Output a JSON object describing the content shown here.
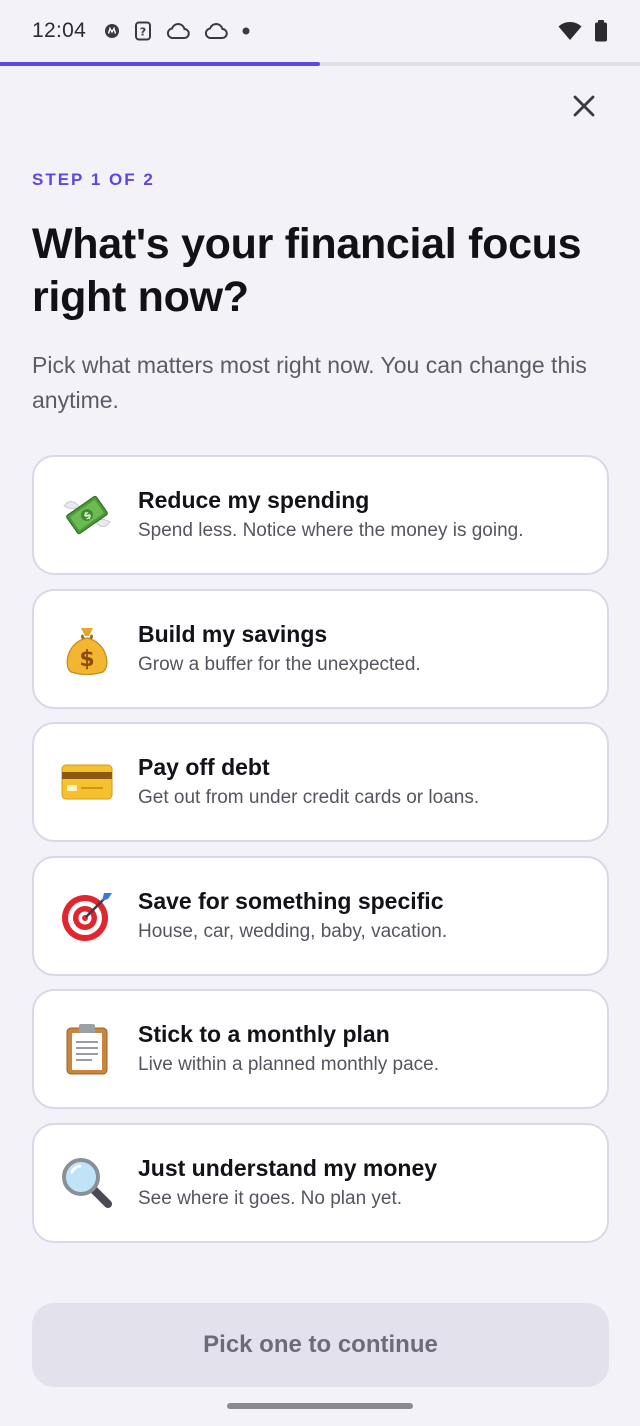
{
  "status_bar": {
    "time": "12:04",
    "icons_left": [
      "circle-badge-icon",
      "sim-question-icon",
      "cloud-icon",
      "cloud-icon",
      "dot-icon"
    ],
    "icons_right": [
      "wifi-icon",
      "battery-icon"
    ]
  },
  "progress": {
    "fraction": 0.5,
    "color": "#5b48e0"
  },
  "header": {
    "step": "STEP 1 OF 2",
    "title": "What's your financial focus right now?",
    "subtitle": "Pick what matters most right now. You can change this anytime."
  },
  "options": [
    {
      "icon": "money-with-wings-icon",
      "title": "Reduce my spending",
      "description": "Spend less. Notice where the money is going."
    },
    {
      "icon": "money-bag-icon",
      "title": "Build my savings",
      "description": "Grow a buffer for the unexpected."
    },
    {
      "icon": "credit-card-icon",
      "title": "Pay off debt",
      "description": "Get out from under credit cards or loans."
    },
    {
      "icon": "target-icon",
      "title": "Save for something specific",
      "description": "House, car, wedding, baby, vacation."
    },
    {
      "icon": "clipboard-icon",
      "title": "Stick to a monthly plan",
      "description": "Live within a planned monthly pace."
    },
    {
      "icon": "magnifying-glass-icon",
      "title": "Just understand my money",
      "description": "See where it goes. No plan yet."
    }
  ],
  "footer": {
    "continue_label": "Pick one to continue"
  },
  "colors": {
    "accent": "#5b48e0",
    "background": "#f3f2f9",
    "card_border": "#d9d8e6"
  }
}
